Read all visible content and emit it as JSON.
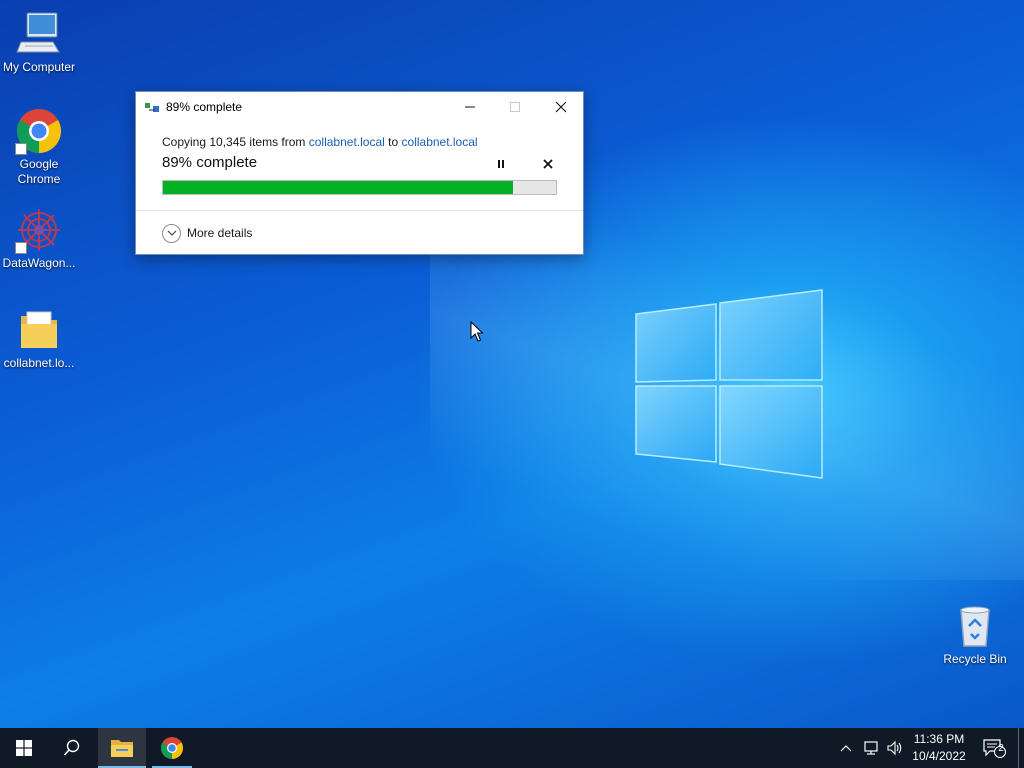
{
  "desktop": {
    "icons": [
      {
        "label": "My Computer",
        "icon": "computer-icon"
      },
      {
        "label": "Google Chrome",
        "icon": "chrome-icon"
      },
      {
        "label": "DataWagon...",
        "icon": "datawagon-icon"
      },
      {
        "label": "collabnet.lo...",
        "icon": "folder-icon"
      }
    ],
    "recycle_bin": {
      "label": "Recycle Bin",
      "icon": "recycle-bin-icon"
    }
  },
  "copy_dialog": {
    "title": "89% complete",
    "copy_prefix": "Copying 10,345 items from",
    "source": "collabnet.local",
    "to_word": "to",
    "destination": "collabnet.local",
    "percent_label": "89% complete",
    "progress": 0.89,
    "more_details_label": "More details"
  },
  "taskbar": {
    "clock_time": "11:36 PM",
    "clock_date": "10/4/2022",
    "notification_count": "2"
  },
  "colors": {
    "progress_green": "#06b025",
    "link_blue": "#1a5fb4",
    "taskbar_bg": "#101a26"
  }
}
